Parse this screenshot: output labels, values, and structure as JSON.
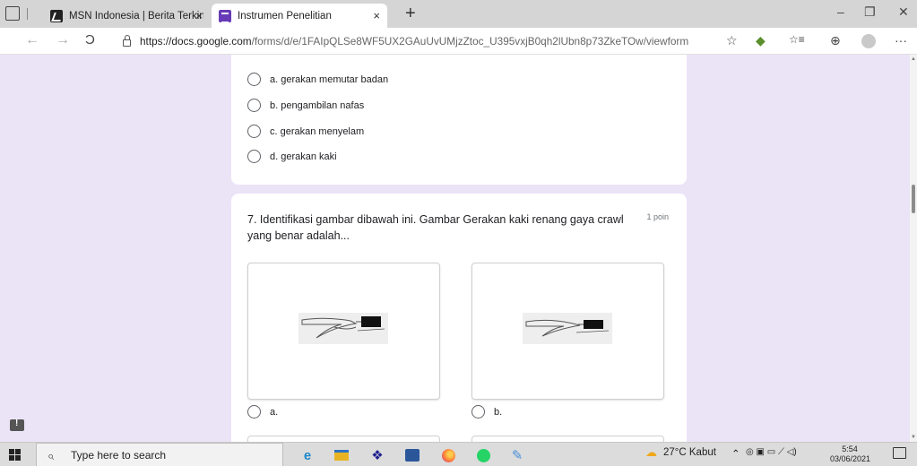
{
  "browser": {
    "tabs": [
      {
        "title": "MSN Indonesia | Berita Terkini Hari Ini",
        "active": false
      },
      {
        "title": "Instrumen Penelitian",
        "active": true
      }
    ],
    "close_glyph": "×",
    "new_tab_glyph": "+",
    "url": {
      "host": "https://docs.google.com",
      "path": "/forms/d/e/1FAIpQLSe8WF5UX2GAuUvUMjzZtoc_U395vxjB0qh2lUbn8p73ZkeTOw/viewform"
    },
    "window_controls": {
      "minimize": "–",
      "maximize": "❐",
      "close": "✕"
    },
    "nav_icons": {
      "back": "←",
      "forward": "→",
      "refresh": "C"
    },
    "toolbar_icons": {
      "favorite": "☆",
      "extension": "◆",
      "favorites_bar": "☆≡",
      "collections": "⊕",
      "more": "···"
    }
  },
  "form": {
    "question6_options": [
      {
        "label": "a. gerakan memutar badan"
      },
      {
        "label": "b. pengambilan nafas"
      },
      {
        "label": "c. gerakan menyelam"
      },
      {
        "label": "d. gerakan kaki"
      }
    ],
    "question7": {
      "title": "7. Identifikasi gambar dibawah ini. Gambar Gerakan kaki renang gaya crawl yang benar adalah...",
      "points": "1 poin",
      "image_options": [
        {
          "label": "a."
        },
        {
          "label": "b."
        }
      ]
    },
    "accent_color": "#673ab7",
    "background_color": "#ebe4f7"
  },
  "taskbar": {
    "search_placeholder": "Type here to search",
    "weather": "27°C  Kabut",
    "time": "5:54",
    "date": "03/06/2021",
    "apps": [
      "edge-icon",
      "file-explorer-icon",
      "dropbox-icon",
      "word-icon",
      "firefox-icon",
      "whatsapp-icon",
      "paint-icon"
    ]
  }
}
